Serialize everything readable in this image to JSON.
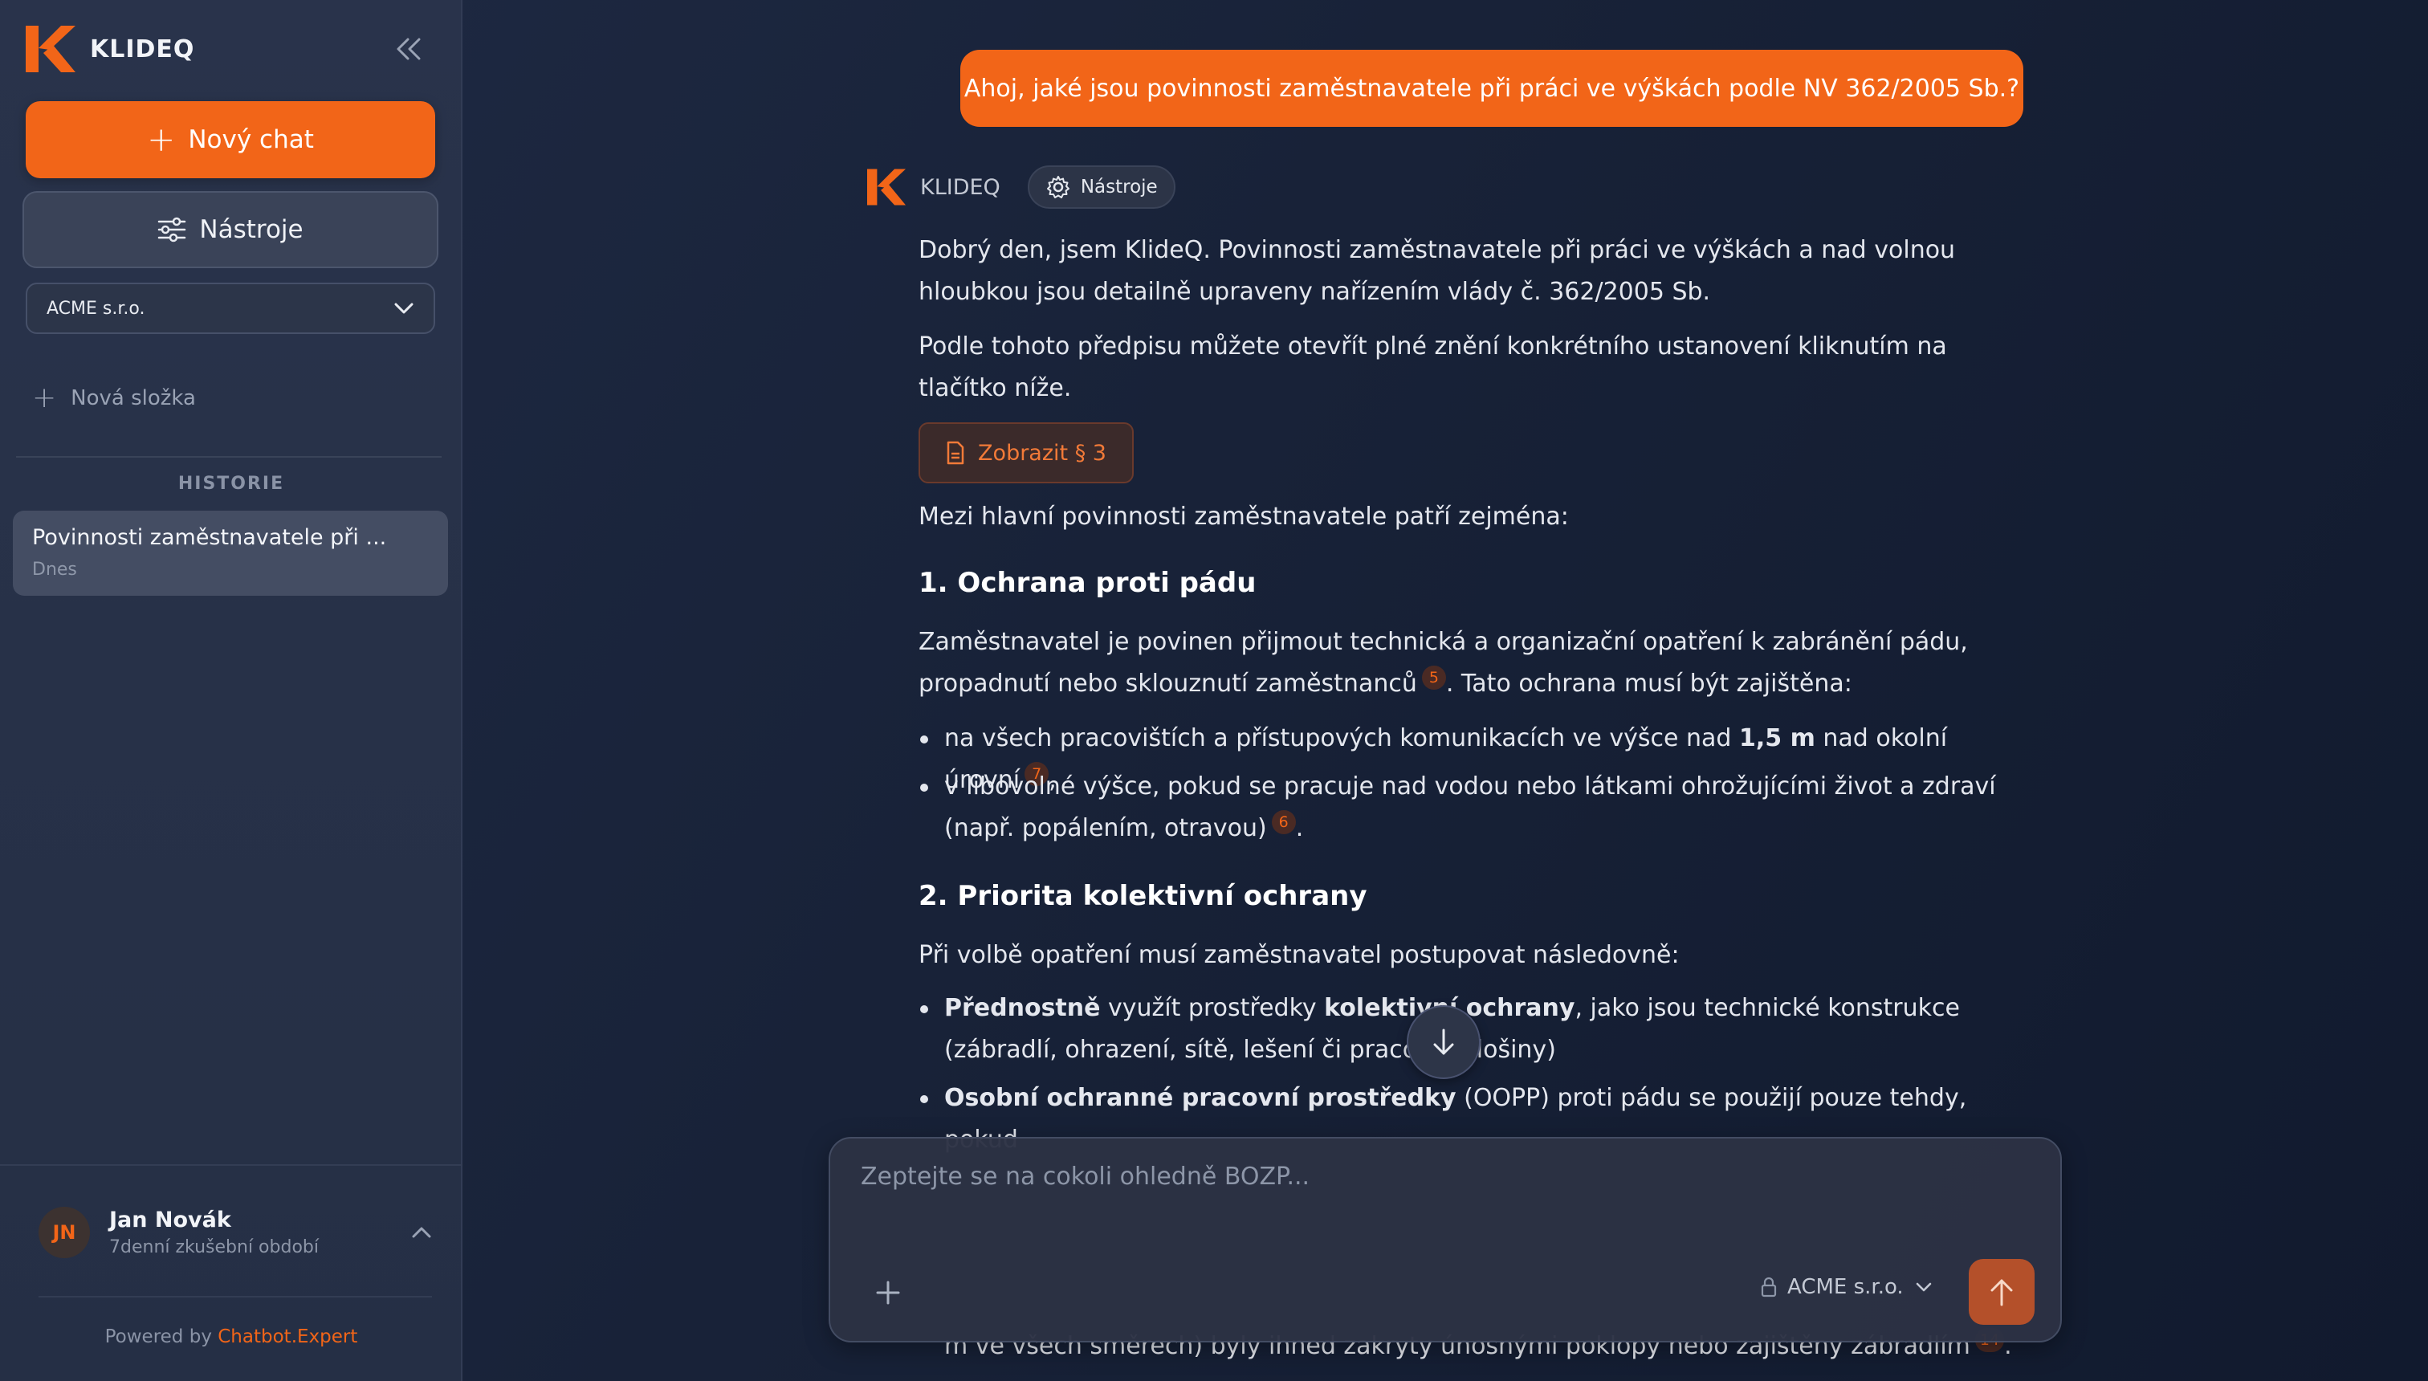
{
  "sidebar": {
    "brand": "KLIDEQ",
    "new_chat_label": "Nový chat",
    "tools_label": "Nástroje",
    "org_select_value": "ACME s.r.o.",
    "new_folder_label": "Nová složka",
    "history_title": "HISTORIE",
    "history_items": [
      {
        "title": "Povinnosti zaměstnavatele při ...",
        "date": "Dnes"
      }
    ],
    "user": {
      "initials": "JN",
      "name": "Jan Novák",
      "subtitle": "7denní zkušební období"
    },
    "powered_prefix": "Powered by",
    "powered_link": "Chatbot.Expert"
  },
  "chat": {
    "user_message": "Ahoj, jaké jsou povinnosti zaměstnavatele při práci ve výškách podle NV 362/2005 Sb.?",
    "bot_name": "KLIDEQ",
    "bot_tools_label": "Nástroje",
    "p1": "Dobrý den, jsem KlideQ. Povinnosti zaměstnavatele při práci ve výškách a nad volnou hloubkou jsou detailně upraveny nařízením vlády č. 362/2005 Sb.",
    "p2": "Podle tohoto předpisu můžete otevřít plné znění konkrétního ustanovení kliknutím na tlačítko níže.",
    "show_button": "Zobrazit § 3",
    "p3": "Mezi hlavní povinnosti zaměstnavatele patří zejména:",
    "h1": "1. Ochrana proti pádu",
    "p4a": "Zaměstnavatel je povinen přijmout technická a organizační opatření k zabránění pádu, propadnutí nebo sklouznutí zaměstnanců",
    "p4cite": "5",
    "p4b": ". Tato ochrana musí být zajištěna:",
    "b1a": "na všech pracovištích a přístupových komunikacích ve výšce nad ",
    "b1bold": "1,5 m",
    "b1b": " nad okolní úrovní",
    "b1cite": "7",
    "b1c": ",",
    "b2a": "v libovolné výšce, pokud se pracuje nad vodou nebo látkami ohrožujícími život a zdraví (např. popálením, otravou)",
    "b2cite": "6",
    "b2b": ".",
    "h2": "2. Priorita kolektivní ochrany",
    "p5": "Při volbě opatření musí zaměstnavatel postupovat následovně:",
    "b3bold1": "Přednostně",
    "b3a": " využít prostředky ",
    "b3bold2": "kolektivní ochrany",
    "b3b": ", jako jsou technické konstrukce (zábradlí, ohrazení, sítě, lešení či pracovní plošiny)",
    "b4bold": "Osobní ochranné pracovní prostředky",
    "b4a": " (OOPP) proti pádu se použijí pouze tehdy, pokud",
    "bottom_line": "m ve všech směrech) byly ihned zakryty únosnými poklopy nebo zajištěny zábradlím",
    "bottom_cite": "14",
    "bottom_end": "."
  },
  "composer": {
    "placeholder": "Zeptejte se na cokoli ohledně BOZP...",
    "scope_value": "ACME s.r.o."
  },
  "colors": {
    "accent": "#f26518",
    "background": "#182238",
    "sidebar": "#29334b"
  },
  "icons": [
    "klideq-logo-icon",
    "collapse-chevrons-icon",
    "plus-icon",
    "sliders-icon",
    "chevron-down-icon",
    "gear-icon",
    "document-icon",
    "arrow-down-icon",
    "lock-icon",
    "arrow-up-icon",
    "chevron-up-icon"
  ]
}
